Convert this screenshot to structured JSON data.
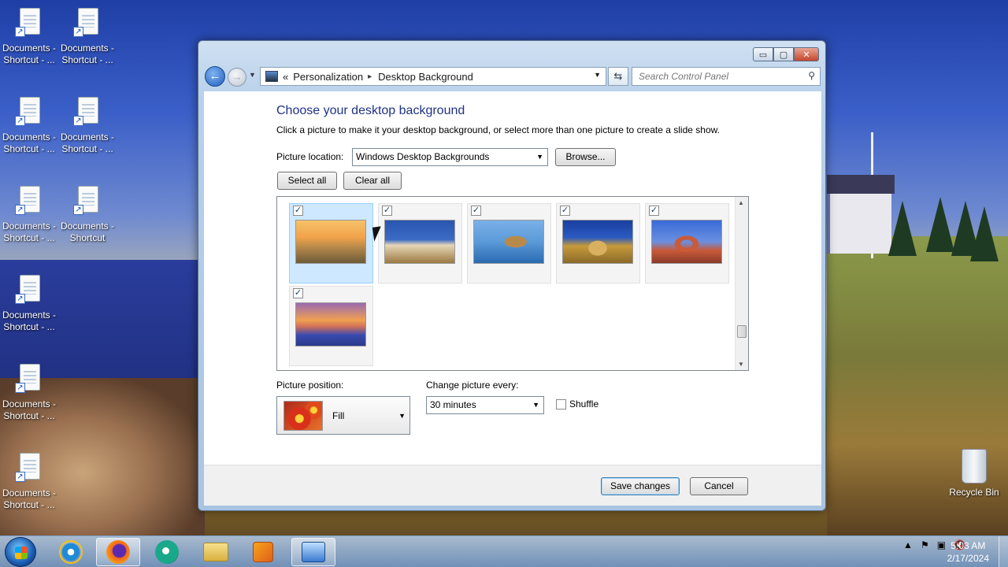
{
  "desktop": {
    "icons": [
      {
        "line1": "Documents -",
        "line2": "Shortcut - ..."
      },
      {
        "line1": "Documents -",
        "line2": "Shortcut - ..."
      },
      {
        "line1": "Documents -",
        "line2": "Shortcut - ..."
      },
      {
        "line1": "Documents -",
        "line2": "Shortcut - ..."
      },
      {
        "line1": "Documents -",
        "line2": "Shortcut - ..."
      },
      {
        "line1": "Documents -",
        "line2": "Shortcut"
      },
      {
        "line1": "Documents -",
        "line2": "Shortcut - ..."
      },
      {
        "line1": "Documents -",
        "line2": "Shortcut - ..."
      },
      {
        "line1": "Documents -",
        "line2": "Shortcut - ..."
      }
    ],
    "recycle_bin": "Recycle Bin"
  },
  "window": {
    "buttons": {
      "minimize": "▭",
      "maximize": "▢",
      "close": "✕"
    },
    "address": {
      "prefix": "«",
      "crumbs": [
        "Personalization",
        "Desktop Background"
      ],
      "separator": "▸"
    },
    "search_placeholder": "Search Control Panel"
  },
  "page": {
    "title": "Choose your desktop background",
    "subtitle": "Click a picture to make it your desktop background, or select more than one picture to create a slide show.",
    "location_label": "Picture location:",
    "location_value": "Windows Desktop Backgrounds",
    "browse": "Browse...",
    "select_all": "Select all",
    "clear_all": "Clear all",
    "thumbnails": [
      {
        "checked": true,
        "selected": true,
        "scene": "sunset-fields",
        "colors": [
          "#f1a24a",
          "#6d5a3a"
        ]
      },
      {
        "checked": true,
        "selected": false,
        "scene": "lighthouse",
        "colors": [
          "#3b6bc4",
          "#9b7a42"
        ]
      },
      {
        "checked": true,
        "selected": false,
        "scene": "sea-rock",
        "colors": [
          "#5a9ad8",
          "#2a6ab0"
        ]
      },
      {
        "checked": true,
        "selected": false,
        "scene": "hay-bale",
        "colors": [
          "#1a3ea0",
          "#c79a3a"
        ]
      },
      {
        "checked": true,
        "selected": false,
        "scene": "arch",
        "colors": [
          "#3a6ad8",
          "#c95a3a"
        ]
      },
      {
        "checked": true,
        "selected": false,
        "scene": "lupine-lake",
        "colors": [
          "#f0a050",
          "#3a4ab0"
        ]
      }
    ],
    "position_label": "Picture position:",
    "position_value": "Fill",
    "change_label": "Change picture every:",
    "change_value": "30 minutes",
    "shuffle": "Shuffle",
    "save": "Save changes",
    "cancel": "Cancel"
  },
  "taskbar": {
    "time": "5:03 AM",
    "date": "2/17/2024"
  }
}
